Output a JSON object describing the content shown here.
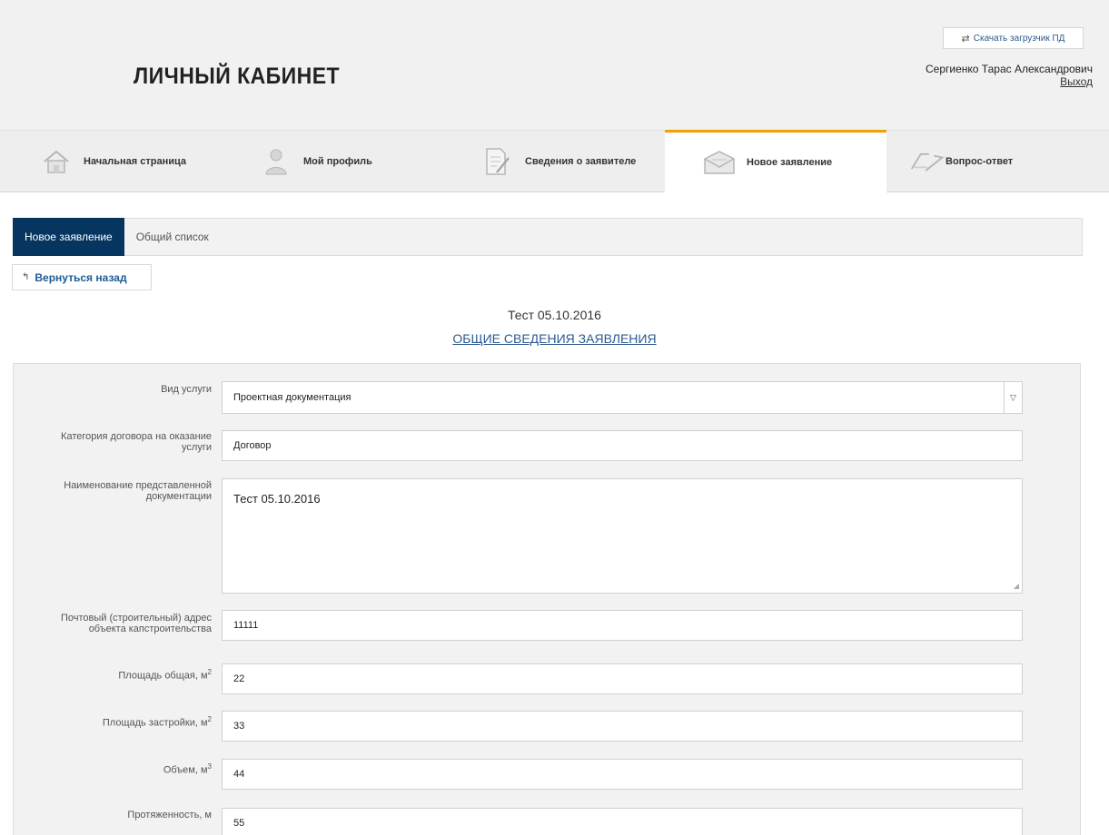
{
  "header": {
    "brand": "ЛИЧНЫЙ КАБИНЕТ",
    "download_label": "Скачать загрузчик ПД",
    "user_name": "Сергиенко Тарас Александрович",
    "logout_label": "Выход"
  },
  "nav": {
    "items": [
      {
        "label": "Начальная страница",
        "icon": "home-icon"
      },
      {
        "label": "Мой профиль",
        "icon": "profile-icon"
      },
      {
        "label": "Сведения о заявителе",
        "icon": "document-edit-icon"
      },
      {
        "label": "Новое заявление",
        "icon": "envelope-icon",
        "active": true
      },
      {
        "label": "Вопрос-ответ",
        "icon": "question-answer-icon"
      }
    ],
    "accent_color": "#f2a100"
  },
  "subtabs": {
    "items": [
      {
        "label": "Новое заявление",
        "active": true
      },
      {
        "label": "Общий список"
      }
    ],
    "active_color": "#06365f"
  },
  "back_label": "Вернуться назад",
  "doc_title": "Тест 05.10.2016",
  "section_title": "ОБЩИЕ СВЕДЕНИЯ ЗАЯВЛЕНИЯ",
  "form": {
    "service_type": {
      "label": "Вид услуги",
      "value": "Проектная документация"
    },
    "contract_category": {
      "label": "Категория договора на оказание услуги",
      "value": "Договор"
    },
    "doc_name": {
      "label": "Наименование представленной документации",
      "value": "Тест 05.10.2016"
    },
    "address": {
      "label": "Почтовый (строительный) адрес объекта капстроительства",
      "value": "11111"
    },
    "area_total": {
      "label": "Площадь общая, м",
      "unit_power": "2",
      "value": "22"
    },
    "area_build": {
      "label": "Площадь застройки, м",
      "unit_power": "2",
      "value": "33"
    },
    "volume": {
      "label": "Объем, м",
      "unit_power": "3",
      "value": "44"
    },
    "length": {
      "label": "Протяженность, м",
      "value": "55"
    }
  }
}
